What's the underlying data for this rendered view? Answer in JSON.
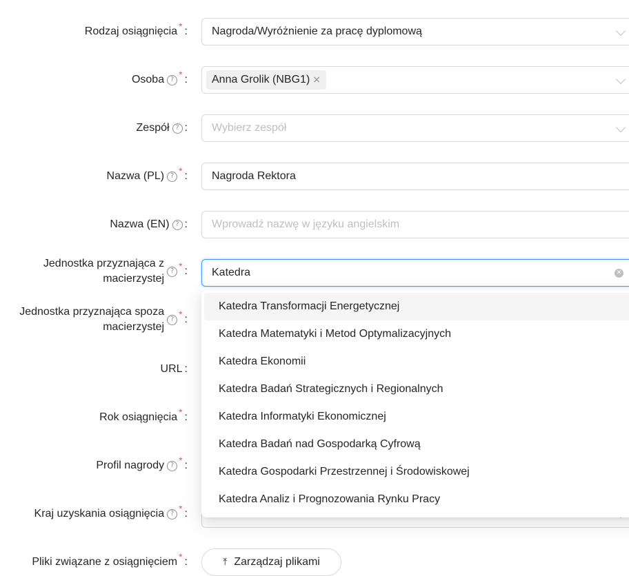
{
  "labels": {
    "rodzaj": "Rodzaj osiągnięcia",
    "osoba": "Osoba",
    "zespol": "Zespół",
    "nazwa_pl": "Nazwa (PL)",
    "nazwa_en": "Nazwa (EN)",
    "jednostka_macierzysta": "Jednostka przyznająca z macierzystej",
    "jednostka_spoza": "Jednostka przyznająca spoza macierzystej",
    "url": "URL",
    "rok": "Rok osiągnięcia",
    "profil": "Profil nagrody",
    "kraj": "Kraj uzyskania osiągnięcia",
    "pliki": "Pliki związane z osiągnięciem"
  },
  "required_mark": "*",
  "colon": ":",
  "help_glyph": "?",
  "values": {
    "rodzaj": "Nagroda/Wyróżnienie za pracę dyplomową",
    "osoba_tag": "Anna Grolik (NBG1)",
    "tag_remove": "×",
    "nazwa_pl": "Nagroda Rektora",
    "jednostka_search": "Katedra"
  },
  "placeholders": {
    "zespol": "Wybierz zespół",
    "nazwa_en": "Wprowadź nazwę w języku angielskim"
  },
  "dropdown_options": [
    "Katedra Transformacji Energetycznej",
    "Katedra Matematyki i Metod Optymalizacyjnych",
    "Katedra Ekonomii",
    "Katedra Badań Strategicznych i Regionalnych",
    "Katedra Informatyki Ekonomicznej",
    "Katedra Badań nad Gospodarką Cyfrową",
    "Katedra Gospodarki Przestrzennej i Środowiskowej",
    "Katedra Analiz i Prognozowania Rynku Pracy"
  ],
  "upload_button": "Zarządzaj plikami",
  "icons": {
    "chevron": "chevron-down-icon",
    "help": "question-circle-icon",
    "clear": "close-circle-icon",
    "upload": "upload-icon"
  },
  "colors": {
    "required": "#ff4d4f",
    "focus_border": "#4096ff",
    "border": "#d9d9d9",
    "placeholder": "#bfbfbf",
    "option_active_bg": "#f5f5f5"
  }
}
